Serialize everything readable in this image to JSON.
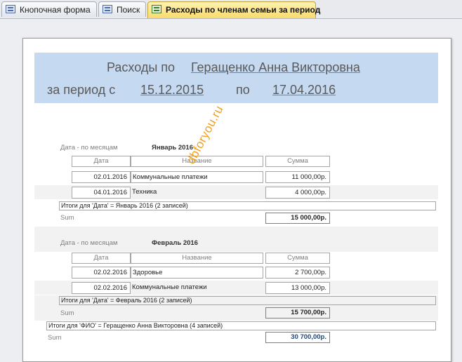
{
  "tabs": [
    {
      "label": "Кнопочная форма",
      "icon": "form-icon"
    },
    {
      "label": "Поиск",
      "icon": "form-icon"
    },
    {
      "label": "Расходы по членам семьи за период",
      "icon": "report-icon",
      "active": true
    }
  ],
  "report": {
    "title_prefix": "Расходы по",
    "member": "Геращенко Анна Викторовна",
    "period_from_label": "за период с",
    "date_from": "15.12.2015",
    "period_to_label": "по",
    "date_to": "17.04.2016",
    "group_label": "Дата - по месяцам",
    "columns": {
      "date": "Дата",
      "name": "Название",
      "sum": "Сумма"
    },
    "groups": [
      {
        "month": "Январь 2016",
        "rows": [
          {
            "date": "02.01.2016",
            "name": "Коммунальные платежи",
            "sum": "11 000,00р."
          },
          {
            "date": "04.01.2016",
            "name": "Техника",
            "sum": "4 000,00р."
          }
        ],
        "summary": "Итоги для 'Дата' = Январь 2016 (2 записей)",
        "sum_label": "Sum",
        "total": "15 000,00р."
      },
      {
        "month": "Февраль 2016",
        "rows": [
          {
            "date": "02.02.2016",
            "name": "Здоровье",
            "sum": "2 700,00р."
          },
          {
            "date": "02.02.2016",
            "name": "Коммунальные платежи",
            "sum": "13 000,00р."
          }
        ],
        "summary": "Итоги для 'Дата' = Февраль 2016 (2 записей)",
        "sum_label": "Sum",
        "total": "15 700,00р."
      }
    ],
    "fio_summary": "Итоги для 'ФИО' = Геращенко Анна Викторовна (4 записей)",
    "fio_sum_label": "Sum",
    "fio_total": "30 700,00р."
  },
  "watermark": "dbforyou.ru"
}
